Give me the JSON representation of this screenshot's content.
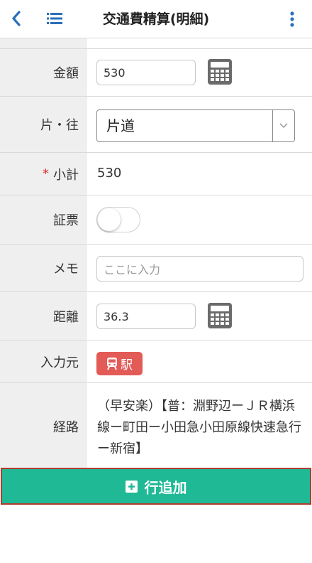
{
  "header": {
    "title": "交通費精算(明細)",
    "back_icon": "chevron-left-icon",
    "list_icon": "list-icon",
    "more_icon": "more-vertical-icon",
    "accent": "#2a6fba"
  },
  "form": {
    "amount": {
      "label": "金額",
      "value": "530",
      "icon": "calculator-icon"
    },
    "trip_type": {
      "label": "片・往",
      "selected": "片道"
    },
    "subtotal": {
      "label": "小計",
      "required_mark": "*",
      "value": "530"
    },
    "receipt": {
      "label": "証票",
      "toggle_on": false
    },
    "memo": {
      "label": "メモ",
      "placeholder": "ここに入力"
    },
    "distance": {
      "label": "距離",
      "value": "36.3",
      "icon": "calculator-icon"
    },
    "source": {
      "label": "入力元",
      "badge_text": "駅",
      "badge_color": "#e35b57"
    },
    "route": {
      "label": "経路",
      "value": "（早安楽）【普：淵野辺ーＪＲ横浜線ー町田ー小田急小田原線快速急行ー新宿】"
    }
  },
  "footer": {
    "add_label": "行追加",
    "button_color": "#1fb996"
  }
}
